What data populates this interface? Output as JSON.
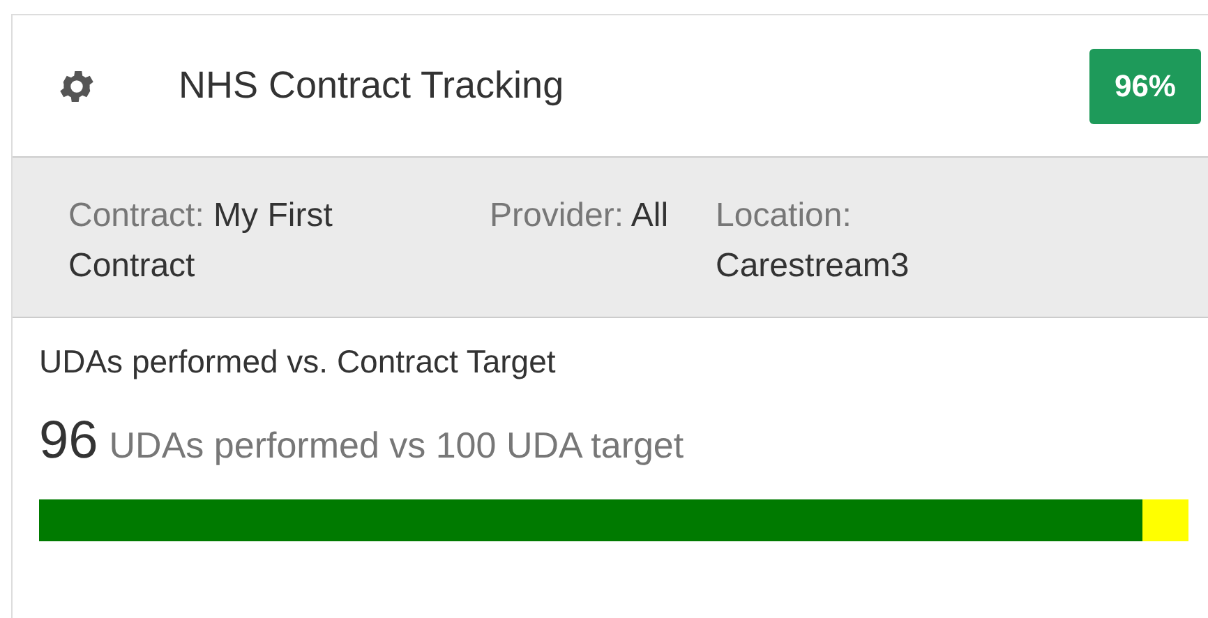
{
  "header": {
    "title": "NHS Contract Tracking",
    "badge": "96%"
  },
  "details": [
    {
      "label": "Contract:",
      "value": "My First Contract"
    },
    {
      "label": "Provider:",
      "value": "All"
    },
    {
      "label": "Location:",
      "value": "Carestream3"
    }
  ],
  "section": {
    "title": "UDAs performed vs. Contract Target",
    "count": "96",
    "caption": "UDAs performed vs 100 UDA target",
    "progress": {
      "level": 0.96
    }
  }
}
